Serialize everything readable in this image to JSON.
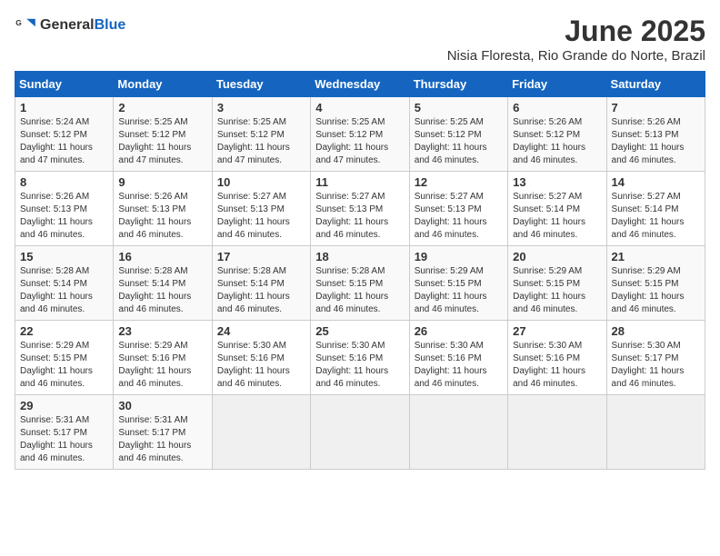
{
  "header": {
    "logo_general": "General",
    "logo_blue": "Blue",
    "title": "June 2025",
    "subtitle": "Nisia Floresta, Rio Grande do Norte, Brazil"
  },
  "calendar": {
    "columns": [
      "Sunday",
      "Monday",
      "Tuesday",
      "Wednesday",
      "Thursday",
      "Friday",
      "Saturday"
    ],
    "weeks": [
      [
        {
          "day": "1",
          "info": "Sunrise: 5:24 AM\nSunset: 5:12 PM\nDaylight: 11 hours\nand 47 minutes."
        },
        {
          "day": "2",
          "info": "Sunrise: 5:25 AM\nSunset: 5:12 PM\nDaylight: 11 hours\nand 47 minutes."
        },
        {
          "day": "3",
          "info": "Sunrise: 5:25 AM\nSunset: 5:12 PM\nDaylight: 11 hours\nand 47 minutes."
        },
        {
          "day": "4",
          "info": "Sunrise: 5:25 AM\nSunset: 5:12 PM\nDaylight: 11 hours\nand 47 minutes."
        },
        {
          "day": "5",
          "info": "Sunrise: 5:25 AM\nSunset: 5:12 PM\nDaylight: 11 hours\nand 46 minutes."
        },
        {
          "day": "6",
          "info": "Sunrise: 5:26 AM\nSunset: 5:12 PM\nDaylight: 11 hours\nand 46 minutes."
        },
        {
          "day": "7",
          "info": "Sunrise: 5:26 AM\nSunset: 5:13 PM\nDaylight: 11 hours\nand 46 minutes."
        }
      ],
      [
        {
          "day": "8",
          "info": "Sunrise: 5:26 AM\nSunset: 5:13 PM\nDaylight: 11 hours\nand 46 minutes."
        },
        {
          "day": "9",
          "info": "Sunrise: 5:26 AM\nSunset: 5:13 PM\nDaylight: 11 hours\nand 46 minutes."
        },
        {
          "day": "10",
          "info": "Sunrise: 5:27 AM\nSunset: 5:13 PM\nDaylight: 11 hours\nand 46 minutes."
        },
        {
          "day": "11",
          "info": "Sunrise: 5:27 AM\nSunset: 5:13 PM\nDaylight: 11 hours\nand 46 minutes."
        },
        {
          "day": "12",
          "info": "Sunrise: 5:27 AM\nSunset: 5:13 PM\nDaylight: 11 hours\nand 46 minutes."
        },
        {
          "day": "13",
          "info": "Sunrise: 5:27 AM\nSunset: 5:14 PM\nDaylight: 11 hours\nand 46 minutes."
        },
        {
          "day": "14",
          "info": "Sunrise: 5:27 AM\nSunset: 5:14 PM\nDaylight: 11 hours\nand 46 minutes."
        }
      ],
      [
        {
          "day": "15",
          "info": "Sunrise: 5:28 AM\nSunset: 5:14 PM\nDaylight: 11 hours\nand 46 minutes."
        },
        {
          "day": "16",
          "info": "Sunrise: 5:28 AM\nSunset: 5:14 PM\nDaylight: 11 hours\nand 46 minutes."
        },
        {
          "day": "17",
          "info": "Sunrise: 5:28 AM\nSunset: 5:14 PM\nDaylight: 11 hours\nand 46 minutes."
        },
        {
          "day": "18",
          "info": "Sunrise: 5:28 AM\nSunset: 5:15 PM\nDaylight: 11 hours\nand 46 minutes."
        },
        {
          "day": "19",
          "info": "Sunrise: 5:29 AM\nSunset: 5:15 PM\nDaylight: 11 hours\nand 46 minutes."
        },
        {
          "day": "20",
          "info": "Sunrise: 5:29 AM\nSunset: 5:15 PM\nDaylight: 11 hours\nand 46 minutes."
        },
        {
          "day": "21",
          "info": "Sunrise: 5:29 AM\nSunset: 5:15 PM\nDaylight: 11 hours\nand 46 minutes."
        }
      ],
      [
        {
          "day": "22",
          "info": "Sunrise: 5:29 AM\nSunset: 5:15 PM\nDaylight: 11 hours\nand 46 minutes."
        },
        {
          "day": "23",
          "info": "Sunrise: 5:29 AM\nSunset: 5:16 PM\nDaylight: 11 hours\nand 46 minutes."
        },
        {
          "day": "24",
          "info": "Sunrise: 5:30 AM\nSunset: 5:16 PM\nDaylight: 11 hours\nand 46 minutes."
        },
        {
          "day": "25",
          "info": "Sunrise: 5:30 AM\nSunset: 5:16 PM\nDaylight: 11 hours\nand 46 minutes."
        },
        {
          "day": "26",
          "info": "Sunrise: 5:30 AM\nSunset: 5:16 PM\nDaylight: 11 hours\nand 46 minutes."
        },
        {
          "day": "27",
          "info": "Sunrise: 5:30 AM\nSunset: 5:16 PM\nDaylight: 11 hours\nand 46 minutes."
        },
        {
          "day": "28",
          "info": "Sunrise: 5:30 AM\nSunset: 5:17 PM\nDaylight: 11 hours\nand 46 minutes."
        }
      ],
      [
        {
          "day": "29",
          "info": "Sunrise: 5:31 AM\nSunset: 5:17 PM\nDaylight: 11 hours\nand 46 minutes."
        },
        {
          "day": "30",
          "info": "Sunrise: 5:31 AM\nSunset: 5:17 PM\nDaylight: 11 hours\nand 46 minutes."
        },
        {
          "day": "",
          "info": ""
        },
        {
          "day": "",
          "info": ""
        },
        {
          "day": "",
          "info": ""
        },
        {
          "day": "",
          "info": ""
        },
        {
          "day": "",
          "info": ""
        }
      ]
    ]
  }
}
